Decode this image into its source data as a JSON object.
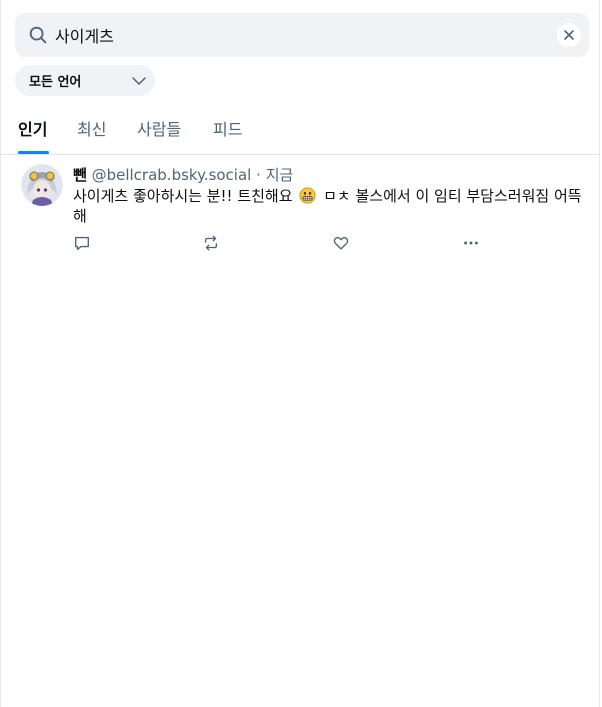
{
  "search": {
    "value": "사이게츠",
    "placeholder": "검색"
  },
  "language_filter": {
    "selected": "모든 언어"
  },
  "tabs": [
    {
      "label": "인기",
      "active": true
    },
    {
      "label": "최신",
      "active": false
    },
    {
      "label": "사람들",
      "active": false
    },
    {
      "label": "피드",
      "active": false
    }
  ],
  "post": {
    "display_name": "뺀",
    "handle": "@bellcrab.bsky.social",
    "separator": "·",
    "time": "지금",
    "text_before_emoji": "사이게츠 좋아하시는 분!! 트친해요",
    "text_after_emoji": "ㅁㅊ 볼스에서 이 임티 부담스러워짐 어뜩해",
    "emoji": "grimacing-face"
  },
  "colors": {
    "accent": "#1083fe",
    "muted_text": "#4f6479",
    "surface": "#f0f2f5"
  }
}
